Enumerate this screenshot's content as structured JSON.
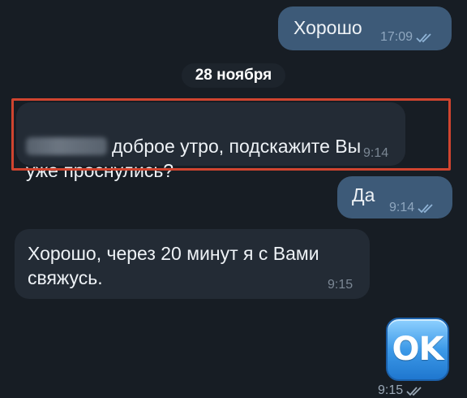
{
  "date_separator": "28 ноября",
  "messages": [
    {
      "direction": "outgoing",
      "text": "Хорошо",
      "time": "17:09",
      "status": "read"
    },
    {
      "direction": "incoming",
      "name_blurred": true,
      "text": "доброе утро, подскажите Вы\nуже проснулись?",
      "time": "9:14",
      "highlighted": true
    },
    {
      "direction": "outgoing",
      "text": "Да",
      "time": "9:14",
      "status": "read"
    },
    {
      "direction": "incoming",
      "text": "Хорошо, через 20 минут я с Вами\nсвяжусь.",
      "time": "9:15"
    },
    {
      "direction": "outgoing",
      "sticker": "OK",
      "time": "9:15",
      "status": "read"
    }
  ],
  "colors": {
    "background": "#171d24",
    "outgoing_bubble": "#3d5a78",
    "incoming_bubble": "#232b35",
    "highlight_border": "#d0442f"
  },
  "icons": {
    "read_receipt": "double-check-icon",
    "sticker": "ok-sticker-icon"
  }
}
